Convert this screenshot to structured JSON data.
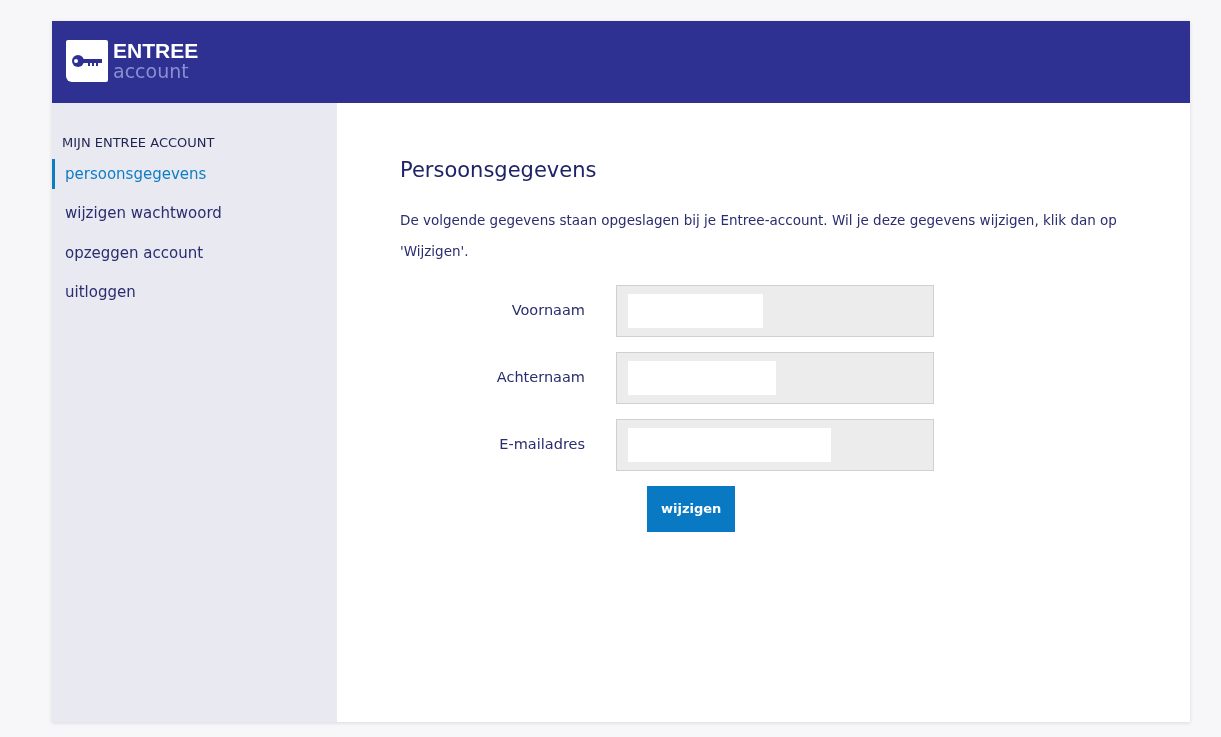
{
  "header": {
    "logo": {
      "title": "ENTREE",
      "subtitle": "account"
    }
  },
  "sidebar": {
    "heading": "MIJN ENTREE ACCOUNT",
    "items": [
      {
        "label": "persoonsgegevens",
        "selected": true
      },
      {
        "label": "wijzigen wachtwoord",
        "selected": false
      },
      {
        "label": "opzeggen account",
        "selected": false
      },
      {
        "label": "uitloggen",
        "selected": false
      }
    ]
  },
  "main": {
    "title": "Persoonsgegevens",
    "intro": "De volgende gegevens staan opgeslagen bij je Entree-account. Wil je deze gegevens wijzigen, klik dan op 'Wijzigen'.",
    "fields": [
      {
        "label": "Voornaam",
        "disabled": true
      },
      {
        "label": "Achternaam",
        "disabled": true
      },
      {
        "label": "E-mailadres",
        "disabled": true
      }
    ],
    "button": "wijzigen"
  }
}
